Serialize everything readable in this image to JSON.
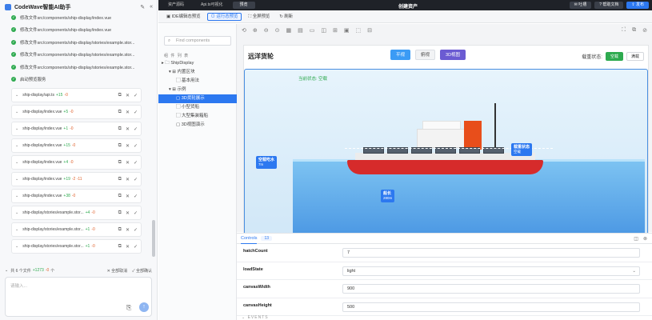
{
  "assistant": {
    "title": "CodeWave智能AI助手",
    "messages": [
      "修改文件src/components/ship-display/index.vue",
      "修改文件src/components/ship-display/index.vue",
      "修改文件src/components/ship-display/stories/example.stor...",
      "修改文件src/components/ship-display/stories/example.stor...",
      "修改文件src/components/ship-display/stories/example.stor...",
      "启动预览服务"
    ],
    "files": [
      {
        "name": "ship-display/api.ts",
        "plus": "+15",
        "minus": "-0"
      },
      {
        "name": "ship-display/index.vue",
        "plus": "+5",
        "minus": "-0"
      },
      {
        "name": "ship-display/index.vue",
        "plus": "+1",
        "minus": "-0"
      },
      {
        "name": "ship-display/index.vue",
        "plus": "+15",
        "minus": "-0"
      },
      {
        "name": "ship-display/index.vue",
        "plus": "+4",
        "minus": "-0"
      },
      {
        "name": "ship-display/index.vue",
        "plus": "+19",
        "minus": "-2 -11"
      },
      {
        "name": "ship-display/index.vue",
        "plus": "+38",
        "minus": "-0"
      },
      {
        "name": "ship-display/stories/example.stor...",
        "plus": "+4",
        "minus": "-0"
      },
      {
        "name": "ship-display/stories/example.stor...",
        "plus": "+1",
        "minus": "-0"
      },
      {
        "name": "ship-display/stories/example.stor...",
        "plus": "+1",
        "minus": "-0"
      }
    ],
    "summary": {
      "text": "共 6 个文件",
      "plus": "+1273",
      "minus": "-0",
      "unit": "个",
      "cancel_all": "全部取消",
      "confirm_all": "全部确认"
    },
    "input_placeholder": "请输入..."
  },
  "topbar": {
    "tabs": [
      "资产源码",
      "Api.ts可视化",
      "预览"
    ],
    "title": "创建资产",
    "feedback": "吐槽",
    "help": "帮助文档",
    "publish": "发布"
  },
  "subbar": {
    "ide": "IDE编辑态预览",
    "running": "运行态预览",
    "full": "全屏预览",
    "refresh": "刷新"
  },
  "tree": {
    "search_placeholder": "Find components",
    "header": "组 件 列 表",
    "items": [
      {
        "label": "ShipDisplay",
        "indent": 0,
        "icon": "▸ 🗀"
      },
      {
        "label": "内置区块",
        "indent": 1,
        "icon": "▾ ⊞"
      },
      {
        "label": "基本用法",
        "indent": 2,
        "icon": "▢"
      },
      {
        "label": "示例",
        "indent": 1,
        "icon": "▾ ⊞"
      },
      {
        "label": "3D货轮展示",
        "indent": 2,
        "icon": "▢",
        "selected": true
      },
      {
        "label": "小型货船",
        "indent": 2,
        "icon": "▢"
      },
      {
        "label": "大型集装箱船",
        "indent": 2,
        "icon": "▢"
      },
      {
        "label": "3D视图演示",
        "indent": 2,
        "icon": "▢"
      }
    ]
  },
  "canvas": {
    "title": "远洋货轮",
    "views": [
      "平视",
      "俯视",
      "3D视图"
    ],
    "load_label": "载重状态:",
    "load_options": [
      "空载",
      "满载"
    ],
    "status": "当前状态: 空载",
    "labels": {
      "draft_title": "空载吃水",
      "draft_value": "7m",
      "load_title": "载重状态",
      "load_value": "空载",
      "len_title": "船长",
      "len_value": "280m"
    }
  },
  "panel": {
    "tab": "Controls",
    "count": "13",
    "rows": [
      {
        "label": "hatchCount",
        "value": "7",
        "select": false
      },
      {
        "label": "loadState",
        "value": "light",
        "select": true
      },
      {
        "label": "canvasWidth",
        "value": "900",
        "select": false
      },
      {
        "label": "canvasHeight",
        "value": "500",
        "select": false
      }
    ],
    "events": "EVENTS"
  }
}
